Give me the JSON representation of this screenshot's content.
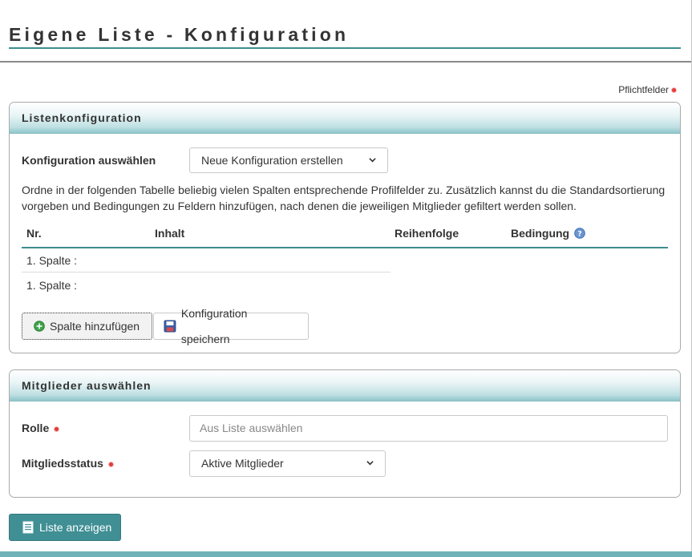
{
  "page": {
    "title": "Eigene Liste - Konfiguration",
    "required_note": "Pflichtfelder"
  },
  "list_config": {
    "header": "Listenkonfiguration",
    "config_label": "Konfiguration auswählen",
    "config_select_value": "Neue Konfiguration erstellen",
    "description": "Ordne in der folgenden Tabelle beliebig vielen Spalten entsprechende Profilfelder zu. Zusätzlich kannst du die Standardsortierung vorgeben und Bedingungen zu Feldern hinzufügen, nach denen die jeweiligen Mitglieder gefiltert werden sollen.",
    "columns": {
      "nr": "Nr.",
      "content": "Inhalt",
      "order": "Reihenfolge",
      "condition": "Bedingung"
    },
    "rows": [
      {
        "label": "1. Spalte :"
      },
      {
        "label": "1. Spalte :"
      }
    ],
    "add_column_label": "Spalte hinzufügen",
    "save_config_label": "Konfiguration speichern"
  },
  "members": {
    "header": "Mitglieder auswählen",
    "role_label": "Rolle",
    "role_placeholder": "Aus Liste auswählen",
    "status_label": "Mitgliedsstatus",
    "status_value": "Aktive Mitglieder"
  },
  "actions": {
    "show_list_label": "Liste anzeigen"
  },
  "colors": {
    "accent": "#3d8d8e",
    "primary_button": "#3f8f94",
    "required": "#e23b3b"
  }
}
